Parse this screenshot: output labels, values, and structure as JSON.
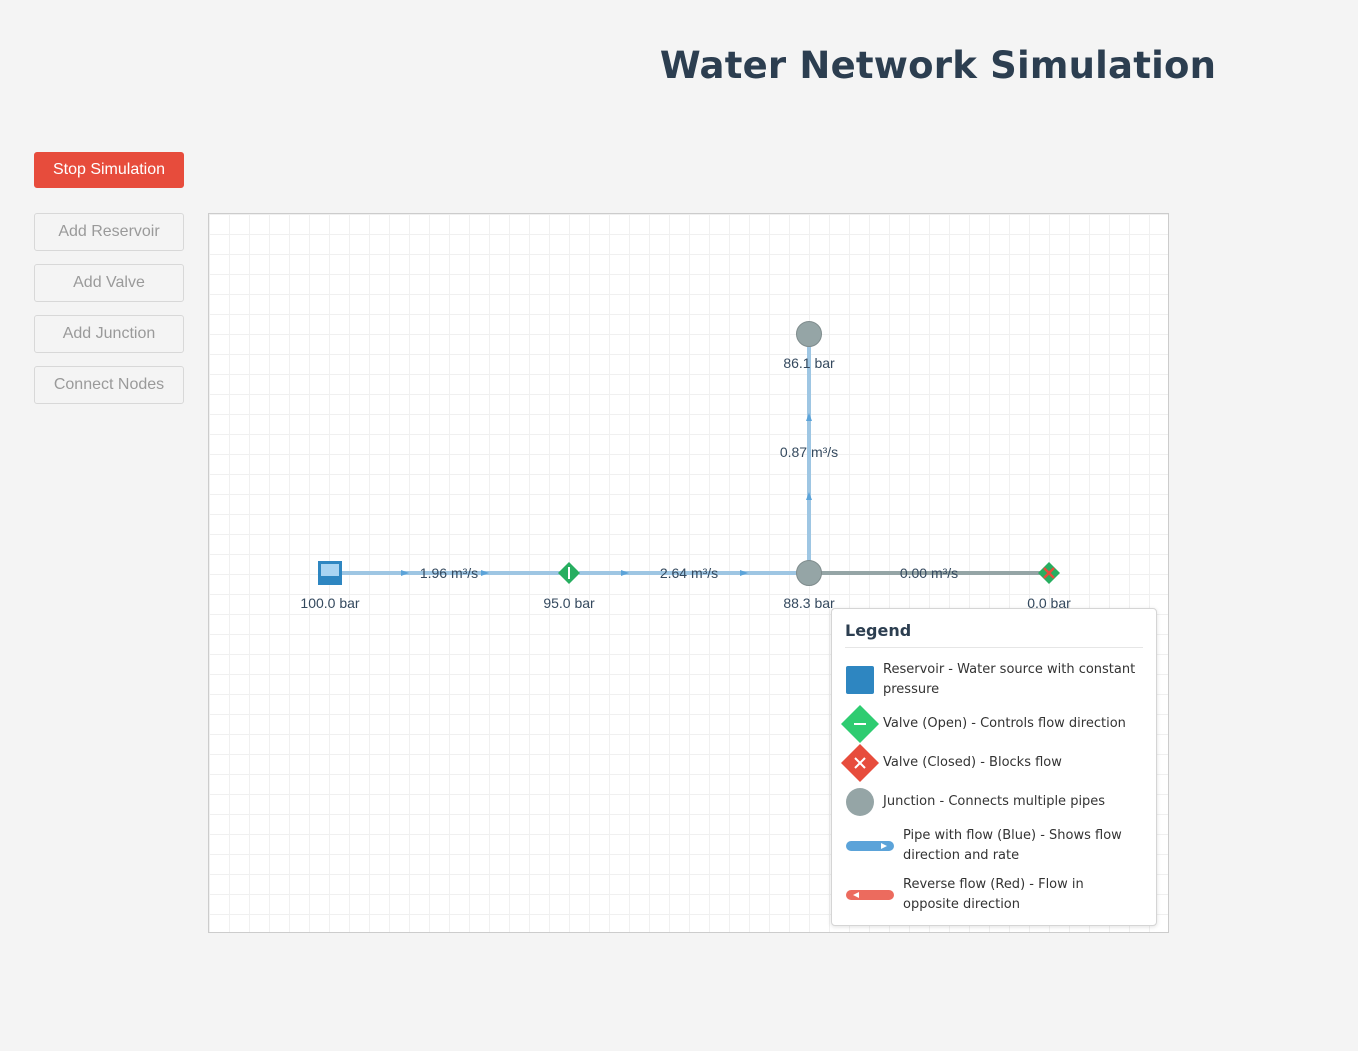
{
  "title": "Water Network Simulation",
  "controls": {
    "stop_label": "Stop Simulation",
    "stop_color": "#e74c3c",
    "tools": [
      {
        "label": "Add Reservoir"
      },
      {
        "label": "Add Valve"
      },
      {
        "label": "Add Junction"
      },
      {
        "label": "Connect Nodes"
      }
    ]
  },
  "network": {
    "nodes": [
      {
        "id": "reservoir-1",
        "type": "reservoir",
        "label": "100.0 bar"
      },
      {
        "id": "valve-1",
        "type": "valve-open",
        "label": "95.0 bar"
      },
      {
        "id": "junction-1",
        "type": "junction",
        "label": "88.3 bar"
      },
      {
        "id": "junction-2",
        "type": "junction",
        "label": "86.1 bar"
      },
      {
        "id": "valve-2",
        "type": "valve-closed",
        "label": "0.0 bar"
      }
    ],
    "pipes": [
      {
        "from": "reservoir-1",
        "to": "valve-1",
        "label": "1.96 m³/s",
        "state": "flow"
      },
      {
        "from": "valve-1",
        "to": "junction-1",
        "label": "2.64 m³/s",
        "state": "flow"
      },
      {
        "from": "junction-1",
        "to": "junction-2",
        "label": "0.87 m³/s",
        "state": "flow"
      },
      {
        "from": "junction-1",
        "to": "valve-2",
        "label": "0.00 m³/s",
        "state": "idle"
      }
    ]
  },
  "colors": {
    "reservoir": "#2e86c1",
    "valve_open": "#2ecc71",
    "valve_closed": "#e74c3c",
    "junction": "#95a5a6",
    "pipe_flow": "#5ba3d9",
    "pipe_reverse": "#ec6b5e",
    "pipe_idle": "#95a5a6"
  },
  "legend": {
    "title": "Legend",
    "items": [
      {
        "icon": "reservoir-icon",
        "text": "Reservoir - Water source with constant pressure"
      },
      {
        "icon": "valve-open-icon",
        "text": "Valve (Open) - Controls flow direction"
      },
      {
        "icon": "valve-closed-icon",
        "text": "Valve (Closed) - Blocks flow"
      },
      {
        "icon": "junction-icon",
        "text": "Junction - Connects multiple pipes"
      },
      {
        "icon": "pipe-flow-icon",
        "text": "Pipe with flow (Blue) - Shows flow direction and rate"
      },
      {
        "icon": "pipe-reverse-icon",
        "text": "Reverse flow (Red) - Flow in opposite direction"
      }
    ]
  }
}
